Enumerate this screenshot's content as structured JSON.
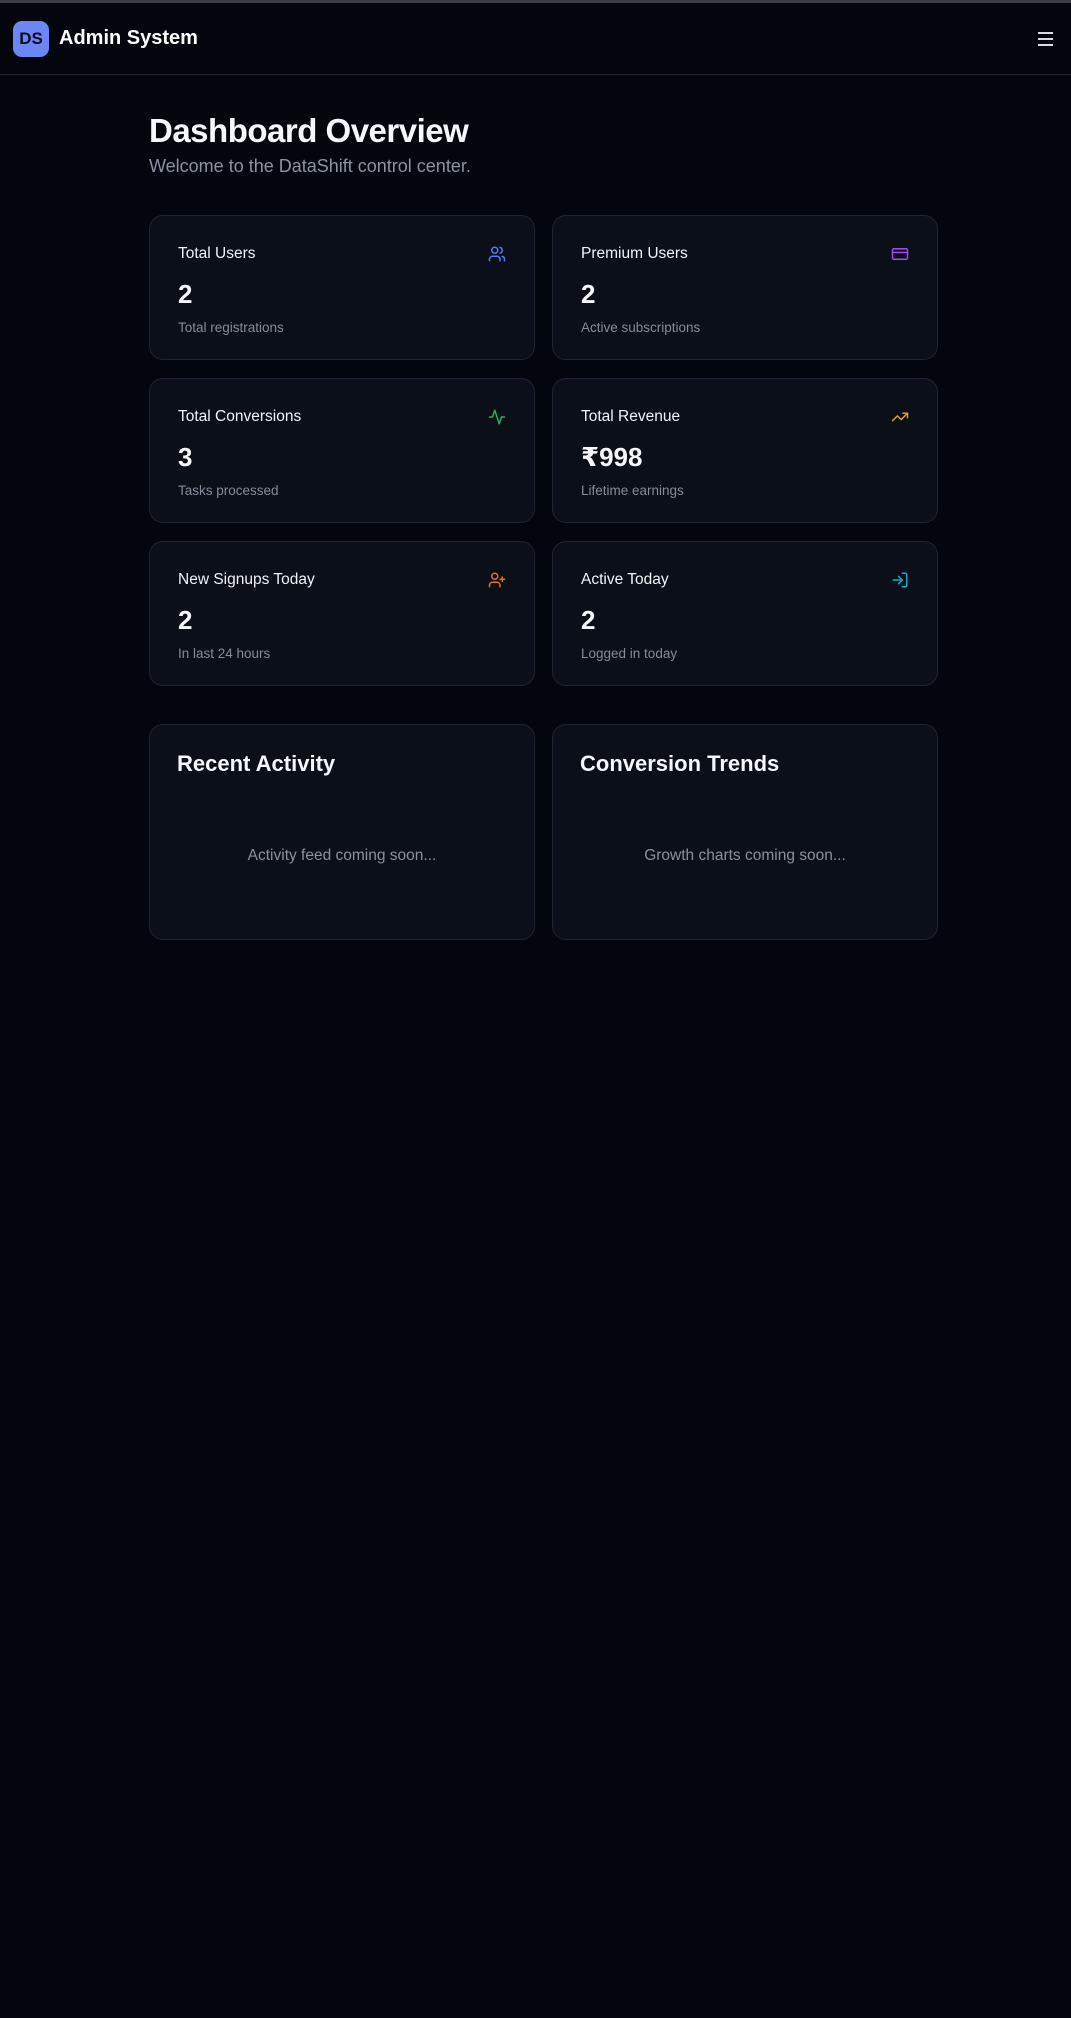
{
  "header": {
    "logo_text": "DS",
    "app_title": "Admin System",
    "menu_icon": "menu-icon"
  },
  "page": {
    "title": "Dashboard Overview",
    "subtitle": "Welcome to the DataShift control center."
  },
  "stats": [
    {
      "label": "Total Users",
      "value": "2",
      "desc": "Total registrations",
      "icon": "users-icon",
      "color": "#4f7ef7"
    },
    {
      "label": "Premium Users",
      "value": "2",
      "desc": "Active subscriptions",
      "icon": "credit-card-icon",
      "color": "#a04cf0"
    },
    {
      "label": "Total Conversions",
      "value": "3",
      "desc": "Tasks processed",
      "icon": "activity-icon",
      "color": "#22b35a"
    },
    {
      "label": "Total Revenue",
      "value": "₹998",
      "desc": "Lifetime earnings",
      "icon": "trending-up-icon",
      "color": "#e0a51c"
    },
    {
      "label": "New Signups Today",
      "value": "2",
      "desc": "In last 24 hours",
      "icon": "user-plus-icon",
      "color": "#ea6a1e"
    },
    {
      "label": "Active Today",
      "value": "2",
      "desc": "Logged in today",
      "icon": "log-in-icon",
      "color": "#17a9c4"
    }
  ],
  "panels": [
    {
      "title": "Recent Activity",
      "placeholder": "Activity feed coming soon..."
    },
    {
      "title": "Conversion Trends",
      "placeholder": "Growth charts coming soon..."
    }
  ],
  "colors": {
    "background": "#04060d",
    "card": "#0b0f18",
    "accent": "#6c86f6"
  }
}
